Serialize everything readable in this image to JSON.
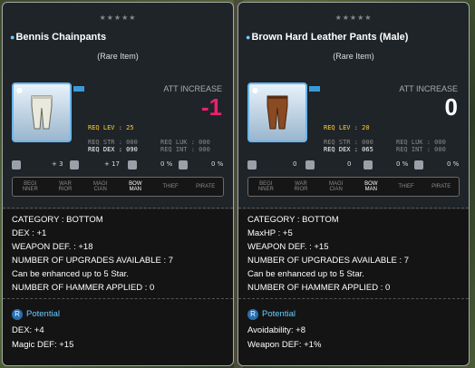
{
  "colors": {
    "accent": "#6cc8ff",
    "req_yellow": "#ffcc33",
    "att_negative": "#e8226f",
    "att_zero": "#ffffff"
  },
  "left": {
    "stars": "★★★★★",
    "name": "Bennis Chainpants",
    "rarity": "(Rare Item)",
    "att_label": "ATT INCREASE",
    "att_value": "-1",
    "req_lev": "REQ LEV :",
    "req_lev_val": "25",
    "req_str": "REQ STR : 000",
    "req_luk": "REQ LUK : 000",
    "req_dex": "REQ DEX : 090",
    "req_int": "REQ INT : 000",
    "s1": "+ 3",
    "s2": "+ 17",
    "s3": "0 %",
    "s4": "0 %",
    "jobs": [
      "BEGI\nNNER",
      "WAR\nRIOR",
      "MAGI\nCIAN",
      "BOW\nMAN",
      "THIEF",
      "PIRATE"
    ],
    "stats": [
      "CATEGORY : BOTTOM",
      "DEX : +1",
      "WEAPON DEF. : +18",
      "NUMBER OF UPGRADES AVAILABLE : 7",
      "Can be enhanced up to 5 Star.",
      "NUMBER OF HAMMER APPLIED : 0"
    ],
    "potential_label": "Potential",
    "potential_badge": "R",
    "potential_lines": [
      "DEX: +4",
      "Magic DEF: +15"
    ]
  },
  "right": {
    "stars": "★★★★★",
    "name": "Brown Hard Leather Pants (Male)",
    "rarity": "(Rare Item)",
    "att_label": "ATT INCREASE",
    "att_value": "0",
    "req_lev": "REQ LEV :",
    "req_lev_val": "20",
    "req_str": "REQ STR : 000",
    "req_luk": "REQ LUK : 000",
    "req_dex": "REQ DEX : 065",
    "req_int": "REQ INT : 000",
    "s1": "0",
    "s2": "0",
    "s3": "0 %",
    "s4": "0 %",
    "jobs": [
      "BEGI\nNNER",
      "WAR\nRIOR",
      "MAGI\nCIAN",
      "BOW\nMAN",
      "THIEF",
      "PIRATE"
    ],
    "stats": [
      "CATEGORY : BOTTOM",
      "MaxHP : +5",
      "WEAPON DEF. : +15",
      "NUMBER OF UPGRADES AVAILABLE : 7",
      "Can be enhanced up to 5 Star.",
      "NUMBER OF HAMMER APPLIED : 0"
    ],
    "potential_label": "Potential",
    "potential_badge": "R",
    "potential_lines": [
      "Avoidability: +8",
      "Weapon DEF: +1%"
    ]
  }
}
